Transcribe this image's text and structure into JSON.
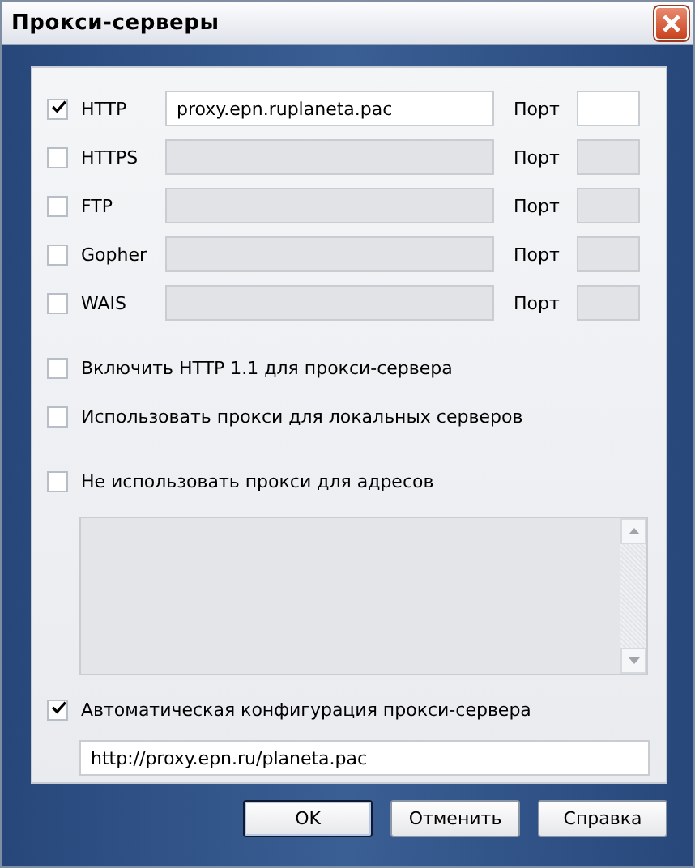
{
  "window": {
    "title": "Прокси-серверы"
  },
  "protocols": [
    {
      "label": "HTTP",
      "checked": true,
      "address": "proxy.epn.ruplaneta.pac",
      "port_label": "Порт"
    },
    {
      "label": "HTTPS",
      "checked": false,
      "port_label": "Порт"
    },
    {
      "label": "FTP",
      "checked": false,
      "port_label": "Порт"
    },
    {
      "label": "Gopher",
      "checked": false,
      "port_label": "Порт"
    },
    {
      "label": "WAIS",
      "checked": false,
      "port_label": "Порт"
    }
  ],
  "options": [
    {
      "label": "Включить HTTP 1.1 для прокси-сервера",
      "checked": false
    },
    {
      "label": "Использовать прокси для локальных серверов",
      "checked": false
    }
  ],
  "bypass": {
    "label": "Не использовать прокси для адресов",
    "checked": false
  },
  "autoconfig": {
    "label": "Автоматическая конфигурация прокси-сервера",
    "checked": true,
    "url": "http://proxy.epn.ru/planeta.pac"
  },
  "buttons": [
    "OK",
    "Отменить",
    "Справка"
  ]
}
